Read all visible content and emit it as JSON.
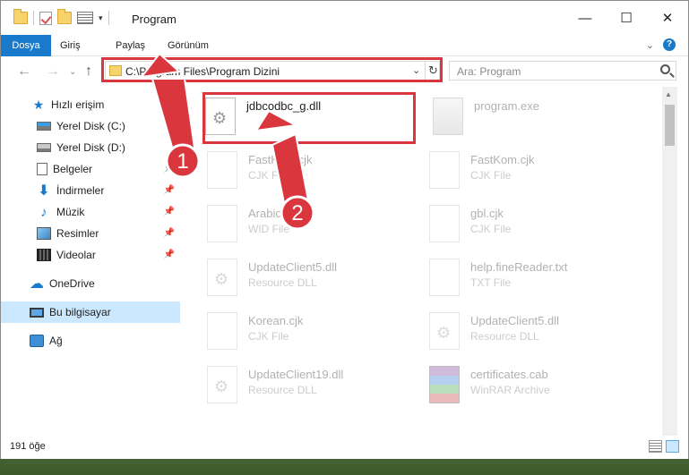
{
  "window": {
    "title": "Program",
    "controls": {
      "minimize": "—",
      "maximize": "☐",
      "close": "✕"
    }
  },
  "ribbon": {
    "tabs": [
      {
        "label": "Dosya",
        "active": true
      },
      {
        "label": "Giriş"
      },
      {
        "label": "Paylaş"
      },
      {
        "label": "Görünüm"
      }
    ],
    "help": "?"
  },
  "navigation": {
    "address": "C:\\Program Files\\Program Dizini",
    "search_placeholder": "Ara: Program"
  },
  "sidebar": {
    "items": [
      {
        "label": "Hızlı erişim",
        "icon": "star-icon"
      },
      {
        "label": "Yerel Disk (C:)",
        "icon": "windows-disk-icon",
        "pinned": true
      },
      {
        "label": "Yerel Disk (D:)",
        "icon": "disk-icon",
        "pinned": true
      },
      {
        "label": "Belgeler",
        "icon": "document-icon",
        "pinned": true
      },
      {
        "label": "İndirmeler",
        "icon": "download-icon",
        "pinned": true
      },
      {
        "label": "Müzik",
        "icon": "music-icon",
        "pinned": true
      },
      {
        "label": "Resimler",
        "icon": "pictures-icon",
        "pinned": true
      },
      {
        "label": "Videolar",
        "icon": "videos-icon",
        "pinned": true
      },
      {
        "label": "OneDrive",
        "icon": "cloud-icon"
      },
      {
        "label": "Bu bilgisayar",
        "icon": "computer-icon",
        "selected": true
      },
      {
        "label": "Ağ",
        "icon": "network-icon"
      }
    ]
  },
  "files": [
    {
      "name": "jdbcodbc_g.dll",
      "type": "",
      "icon": "gear",
      "highlighted": true
    },
    {
      "name": "program.exe",
      "type": "",
      "icon": "exe"
    },
    {
      "name": "FastKom.cjk",
      "type": "CJK File",
      "icon": "blank"
    },
    {
      "name": "FastKom.cjk",
      "type": "CJK File",
      "icon": "blank"
    },
    {
      "name": "Arabic",
      "type": "WID File",
      "icon": "blank"
    },
    {
      "name": "gbl.cjk",
      "type": "CJK File",
      "icon": "blank"
    },
    {
      "name": "UpdateClient5.dll",
      "type": "Resource DLL",
      "icon": "gear"
    },
    {
      "name": "help.fineReader.txt",
      "type": "TXT File",
      "icon": "blank"
    },
    {
      "name": "Korean.cjk",
      "type": "CJK File",
      "icon": "blank"
    },
    {
      "name": "UpdateClient5.dll",
      "type": "Resource DLL",
      "icon": "gear"
    },
    {
      "name": "UpdateClient19.dll",
      "type": "Resource DLL",
      "icon": "gear"
    },
    {
      "name": "certificates.cab",
      "type": "WinRAR Archive",
      "icon": "rar"
    }
  ],
  "annotations": {
    "step1": "1",
    "step2": "2",
    "color": "#d9363e"
  },
  "status": {
    "count": "191 öğe"
  },
  "colors": {
    "accent": "#1979ca",
    "selected": "#cce8ff"
  }
}
